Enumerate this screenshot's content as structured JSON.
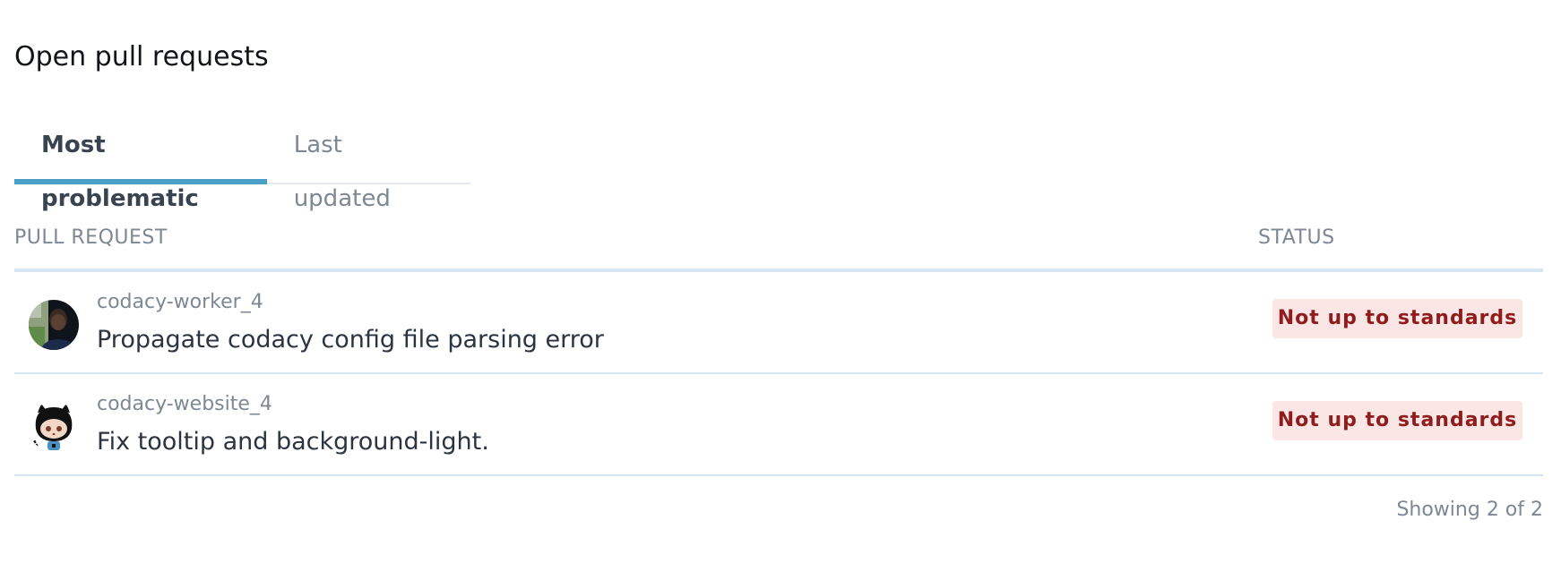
{
  "title": "Open pull requests",
  "tabs": [
    {
      "label": "Most problematic",
      "active": true
    },
    {
      "label": "Last updated",
      "active": false
    }
  ],
  "table": {
    "headers": {
      "pull_request": "PULL REQUEST",
      "status": "STATUS"
    },
    "rows": [
      {
        "repository": "codacy-worker_4",
        "title": "Propagate codacy config file parsing error",
        "status": "Not up to standards",
        "avatar": "user-photo-avatar"
      },
      {
        "repository": "codacy-website_4",
        "title": "Fix tooltip and background-light.",
        "status": "Not up to standards",
        "avatar": "octocat-avatar"
      }
    ]
  },
  "footer": {
    "pagination": "Showing 2 of 2"
  },
  "colors": {
    "tab_active_underline": "#4a9fc8",
    "badge_background": "#fbe6e6",
    "badge_text": "#8f1d1d",
    "row_divider": "#d5e6f1"
  }
}
